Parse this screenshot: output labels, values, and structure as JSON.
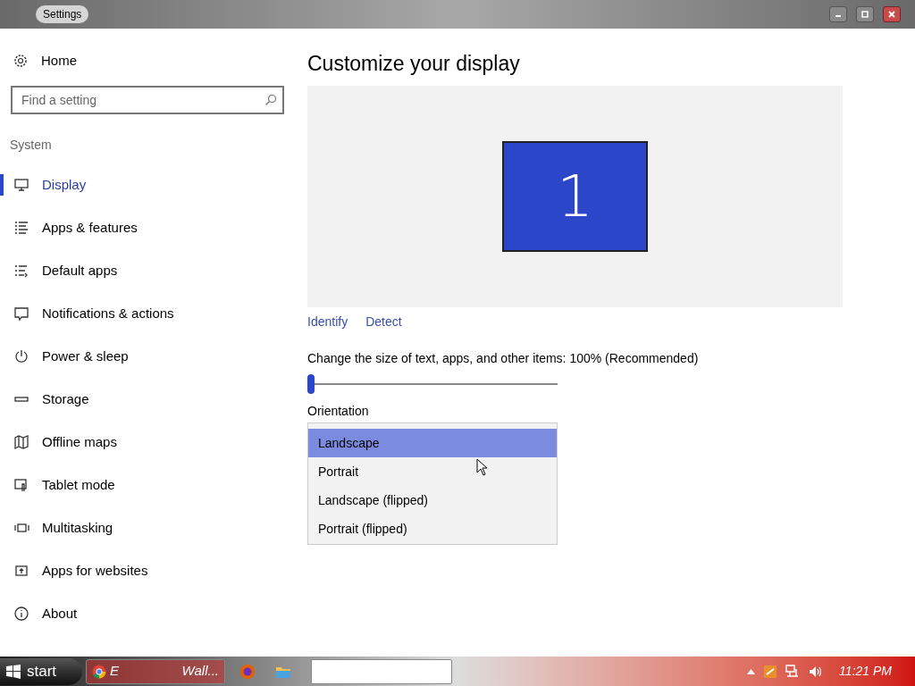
{
  "window": {
    "title": "Settings"
  },
  "sidebar": {
    "home": "Home",
    "search": {
      "placeholder": "Find a setting"
    },
    "section": "System",
    "items": [
      {
        "label": "Display",
        "selected": true
      },
      {
        "label": "Apps & features",
        "selected": false
      },
      {
        "label": "Default apps",
        "selected": false
      },
      {
        "label": "Notifications & actions",
        "selected": false
      },
      {
        "label": "Power & sleep",
        "selected": false
      },
      {
        "label": "Storage",
        "selected": false
      },
      {
        "label": "Offline maps",
        "selected": false
      },
      {
        "label": "Tablet mode",
        "selected": false
      },
      {
        "label": "Multitasking",
        "selected": false
      },
      {
        "label": "Apps for websites",
        "selected": false
      },
      {
        "label": "About",
        "selected": false
      }
    ]
  },
  "content": {
    "title": "Customize your display",
    "monitor": "1",
    "links": [
      "Identify",
      "Detect"
    ],
    "scale": {
      "label": "Change the size of text, apps, and other items: 100% (Recommended)",
      "level": 0
    },
    "orientation": {
      "label": "Orientation",
      "options": [
        {
          "label": "Landscape",
          "selected": true
        },
        {
          "label": "Portrait",
          "selected": false
        },
        {
          "label": "Landscape (flipped)",
          "selected": false
        },
        {
          "label": "Portrait (flipped)",
          "selected": false
        }
      ]
    }
  },
  "taskbar": {
    "start": "start",
    "tasks": [
      {
        "kind": "chrome",
        "label_parts": [
          "E",
          "Wall..."
        ]
      },
      {
        "kind": "firefox"
      },
      {
        "kind": "folder"
      },
      {
        "kind": "blank"
      }
    ],
    "clock": "11:21 PM"
  }
}
